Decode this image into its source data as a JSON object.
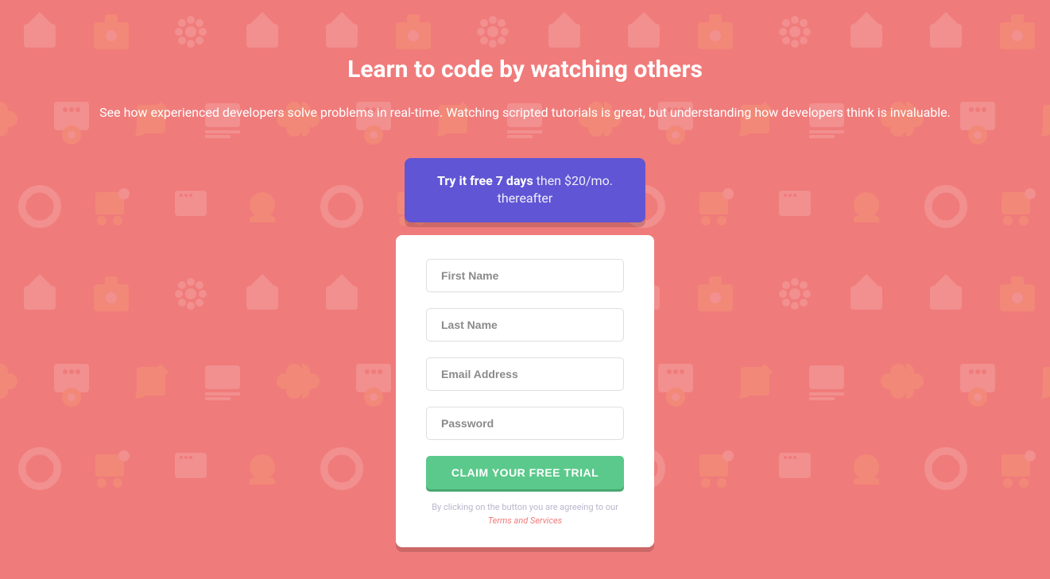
{
  "colors": {
    "background": "#f07b7b",
    "banner": "#6055d4",
    "button": "#5bc98b",
    "white": "#ffffff",
    "termsLink": "#f07b7b"
  },
  "header": {
    "title": "Learn to code by watching others",
    "subtitle": "See how experienced developers solve problems in real-time. Watching scripted tutorials is great, but understanding how developers think is invaluable."
  },
  "promo": {
    "bold": "Try it free 7 days",
    "rest": " then $20/mo. thereafter"
  },
  "form": {
    "fields": {
      "firstName": {
        "placeholder": "First Name",
        "value": ""
      },
      "lastName": {
        "placeholder": "Last Name",
        "value": ""
      },
      "email": {
        "placeholder": "Email Address",
        "value": ""
      },
      "password": {
        "placeholder": "Password",
        "value": ""
      }
    },
    "submitLabel": "CLAIM YOUR FREE TRIAL",
    "termsPrefix": "By clicking on the button you are agreeing to our ",
    "termsLink": "Terms and Services"
  }
}
